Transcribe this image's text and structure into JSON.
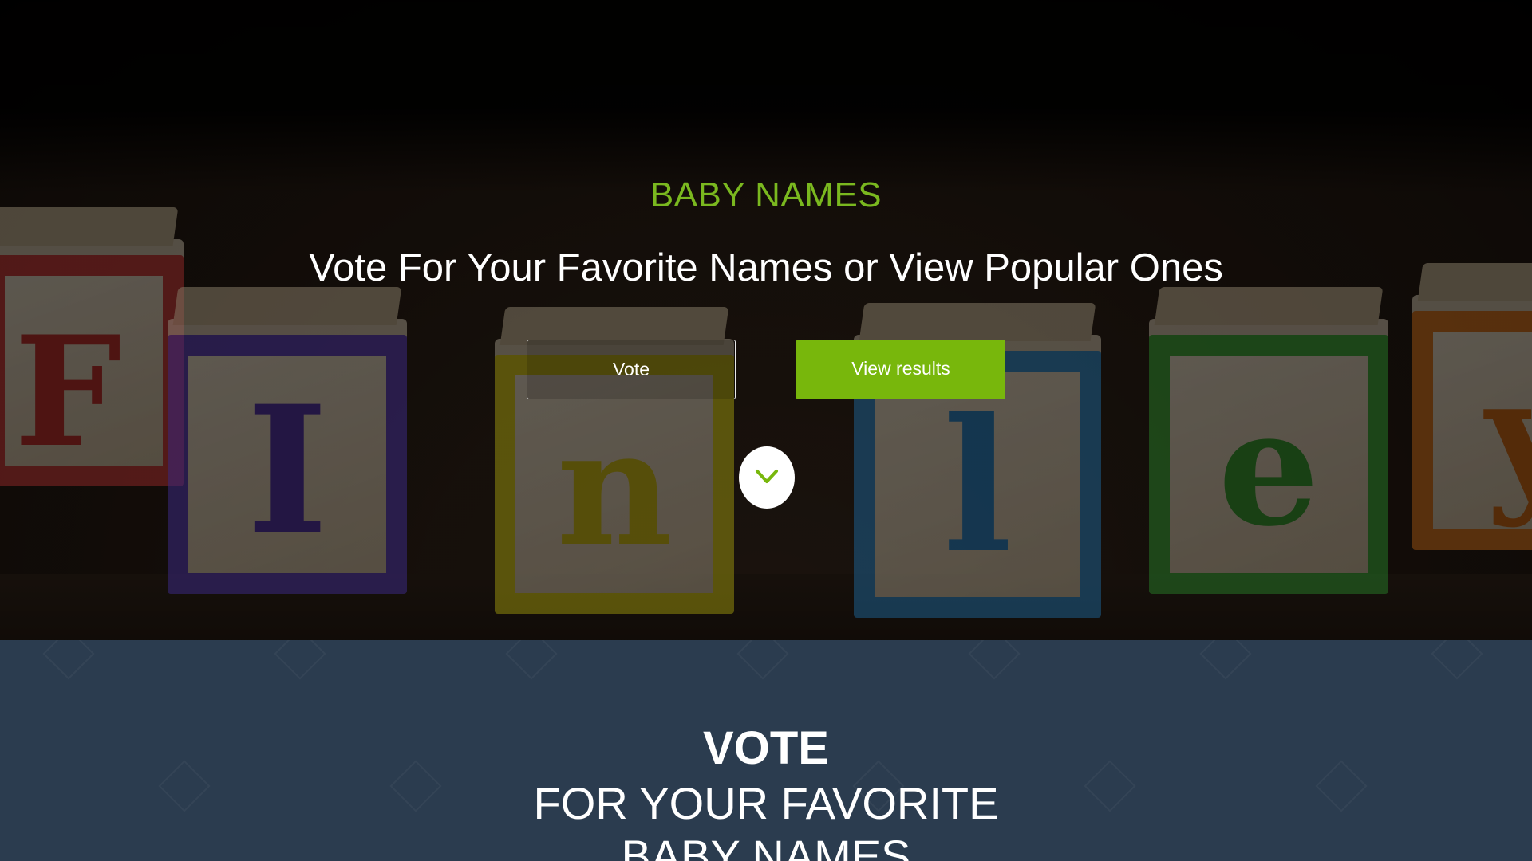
{
  "hero": {
    "brand": "BABY NAMES",
    "headline": "Vote For Your Favorite Names or View Popular Ones",
    "vote_button": "Vote",
    "results_button": "View results",
    "scroll_icon": "chevron-down-icon",
    "block_letters": [
      "F",
      "I",
      "n",
      "l",
      "e",
      "y"
    ]
  },
  "vote_section": {
    "title": "VOTE",
    "subtitle_line1": "FOR YOUR FAVORITE",
    "subtitle_line2": "BABY NAMES"
  },
  "colors": {
    "accent_green": "#78b70c",
    "brand_green": "#7ab81f",
    "section_bg": "#2b3c4f"
  }
}
